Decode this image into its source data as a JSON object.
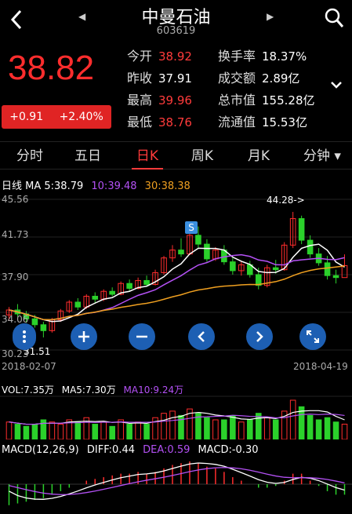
{
  "header": {
    "title": "中曼石油",
    "code": "603619"
  },
  "quote": {
    "price": "38.82",
    "change": "+0.91",
    "change_pct": "+2.40%",
    "stats": [
      {
        "label": "今开",
        "value": "38.92",
        "color": "red"
      },
      {
        "label": "昨收",
        "value": "37.91",
        "color": "white"
      },
      {
        "label": "最高",
        "value": "39.96",
        "color": "red"
      },
      {
        "label": "最低",
        "value": "38.76",
        "color": "red"
      },
      {
        "label": "换手率",
        "value": "18.37%",
        "color": "white"
      },
      {
        "label": "成交额",
        "value": "2.89亿",
        "color": "white"
      },
      {
        "label": "总市值",
        "value": "155.28亿",
        "color": "white"
      },
      {
        "label": "流通值",
        "value": "15.53亿",
        "color": "white"
      }
    ]
  },
  "tabs": [
    "分时",
    "五日",
    "日K",
    "周K",
    "月K",
    "分钟"
  ],
  "active_tab": "日K",
  "ma": {
    "prefix": "日线 MA 5:",
    "ma5": "38.79",
    "ma10": "10:39.48",
    "ma30": "30:38.38"
  },
  "axis": {
    "y_top": "45.56",
    "y_2": "41.73",
    "y_3": "37.90",
    "y_4": "34.06",
    "y_bottom": "30.23",
    "low_marker": "31.51",
    "high_marker": "44.28->",
    "start_date": "2018-02-07",
    "end_date": "2018-04-19",
    "signal_badge": "S"
  },
  "volume": {
    "vol": "VOL:7.35万",
    "ma5": "MA5:7.30万",
    "ma10": "MA10:9.24万"
  },
  "macd": {
    "label": "MACD(12,26,9)",
    "diff": "DIFF:0.44",
    "dea": "DEA:0.59",
    "macd": "MACD:-0.30"
  },
  "colors": {
    "up": "#ff2d2d",
    "down": "#2bd12b",
    "ma5": "#ffffff",
    "ma10": "#b451f5",
    "ma30": "#f0a020",
    "ctrl": "#1d5fb3"
  },
  "chart_data": {
    "type": "candlestick",
    "title": "",
    "ylim": [
      30.23,
      45.56
    ],
    "candles": [
      [
        33.8,
        34.6,
        33.2,
        34.3
      ],
      [
        34.3,
        34.9,
        33.6,
        33.9
      ],
      [
        33.9,
        34.2,
        33.0,
        33.4
      ],
      [
        33.4,
        33.8,
        32.5,
        32.8
      ],
      [
        32.8,
        33.1,
        31.51,
        32.2
      ],
      [
        32.2,
        33.5,
        32.0,
        33.3
      ],
      [
        33.3,
        34.4,
        33.1,
        34.2
      ],
      [
        34.2,
        35.3,
        34.0,
        35.1
      ],
      [
        35.1,
        35.5,
        34.3,
        34.6
      ],
      [
        34.6,
        35.9,
        34.4,
        35.7
      ],
      [
        35.7,
        36.1,
        35.0,
        35.4
      ],
      [
        35.4,
        36.4,
        35.2,
        36.2
      ],
      [
        36.2,
        36.6,
        35.7,
        35.9
      ],
      [
        35.9,
        37.2,
        35.8,
        37.0
      ],
      [
        37.0,
        37.4,
        36.2,
        36.5
      ],
      [
        36.5,
        37.6,
        36.4,
        37.3
      ],
      [
        37.3,
        37.8,
        36.7,
        36.9
      ],
      [
        36.9,
        38.4,
        36.8,
        38.1
      ],
      [
        38.1,
        39.8,
        37.9,
        39.6
      ],
      [
        39.6,
        40.9,
        39.2,
        40.4
      ],
      [
        40.4,
        41.6,
        39.7,
        40.0
      ],
      [
        40.0,
        42.3,
        39.9,
        41.9
      ],
      [
        41.9,
        42.8,
        40.6,
        41.0
      ],
      [
        41.0,
        41.5,
        39.2,
        39.5
      ],
      [
        39.5,
        40.7,
        39.3,
        40.4
      ],
      [
        40.4,
        40.9,
        38.9,
        39.2
      ],
      [
        39.2,
        39.6,
        37.9,
        38.3
      ],
      [
        38.3,
        39.2,
        37.8,
        38.9
      ],
      [
        38.9,
        39.3,
        37.6,
        37.9
      ],
      [
        37.9,
        38.6,
        36.4,
        36.8
      ],
      [
        36.8,
        38.9,
        36.6,
        38.6
      ],
      [
        38.6,
        39.4,
        38.0,
        38.4
      ],
      [
        38.4,
        41.2,
        38.3,
        40.9
      ],
      [
        40.9,
        44.28,
        40.6,
        43.6
      ],
      [
        43.6,
        43.9,
        41.0,
        41.4
      ],
      [
        41.4,
        41.9,
        39.6,
        40.0
      ],
      [
        40.0,
        40.6,
        38.8,
        39.1
      ],
      [
        39.1,
        39.8,
        37.4,
        37.8
      ],
      [
        37.8,
        38.4,
        37.0,
        37.6
      ],
      [
        37.6,
        39.96,
        38.76,
        38.82
      ]
    ],
    "volume": [
      8,
      7,
      6,
      7,
      9,
      8,
      7,
      9,
      8,
      10,
      7,
      8,
      6,
      9,
      7,
      8,
      7,
      10,
      12,
      13,
      11,
      14,
      12,
      10,
      9,
      9,
      11,
      8,
      9,
      12,
      10,
      9,
      13,
      18,
      15,
      11,
      9,
      10,
      8,
      7
    ],
    "volume_up": [
      1,
      0,
      0,
      0,
      0,
      1,
      1,
      1,
      0,
      1,
      0,
      1,
      0,
      1,
      0,
      1,
      0,
      1,
      1,
      1,
      0,
      1,
      0,
      0,
      1,
      0,
      0,
      1,
      0,
      0,
      1,
      0,
      1,
      1,
      0,
      0,
      0,
      0,
      0,
      1
    ],
    "macd_hist": [
      -0.6,
      -0.55,
      -0.5,
      -0.45,
      -0.4,
      -0.3,
      -0.2,
      -0.1,
      0.0,
      0.1,
      0.15,
      0.2,
      0.25,
      0.3,
      0.3,
      0.35,
      0.3,
      0.35,
      0.45,
      0.55,
      0.6,
      0.65,
      0.6,
      0.5,
      0.45,
      0.35,
      0.2,
      0.1,
      0.0,
      -0.1,
      -0.1,
      -0.05,
      0.1,
      0.3,
      0.3,
      0.1,
      -0.05,
      -0.2,
      -0.3,
      -0.3
    ],
    "start_date": "2018-02-07",
    "end_date": "2018-04-19"
  }
}
